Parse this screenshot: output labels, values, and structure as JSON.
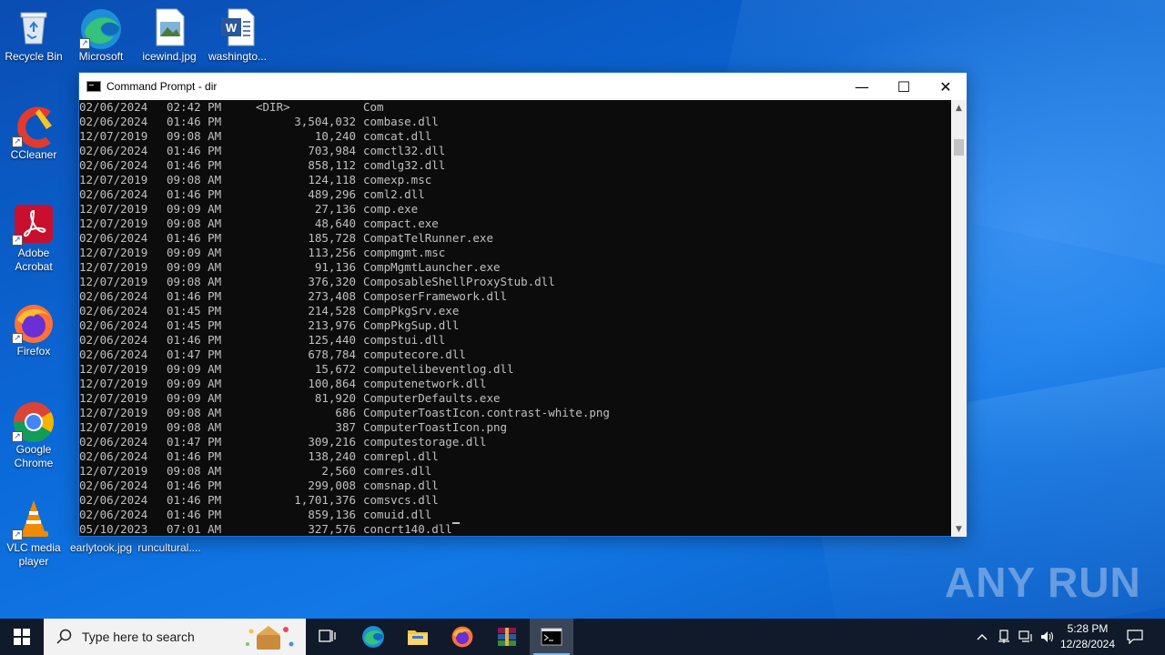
{
  "desktop": {
    "icons": [
      {
        "label": "Recycle Bin"
      },
      {
        "label": "Microsoft Edge"
      },
      {
        "label": "icewind.jpg"
      },
      {
        "label": "washingto..."
      },
      {
        "label": "CCleaner"
      },
      {
        "label": "Adobe Acrobat"
      },
      {
        "label": "Firefox"
      },
      {
        "label": "Google Chrome"
      },
      {
        "label": "VLC media player"
      },
      {
        "label": "earlytook.jpg"
      },
      {
        "label": "runcultural...."
      }
    ],
    "watermark": "ANY RUN"
  },
  "cmd_window": {
    "title": "Command Prompt - dir",
    "minimize": "—",
    "maximize": "☐",
    "close": "✕",
    "lines": [
      {
        "date": "02/06/2024",
        "time": "02:42 PM",
        "size": "<DIR>",
        "name": "Com"
      },
      {
        "date": "02/06/2024",
        "time": "01:46 PM",
        "size": "3,504,032",
        "name": "combase.dll"
      },
      {
        "date": "12/07/2019",
        "time": "09:08 AM",
        "size": "10,240",
        "name": "comcat.dll"
      },
      {
        "date": "02/06/2024",
        "time": "01:46 PM",
        "size": "703,984",
        "name": "comctl32.dll"
      },
      {
        "date": "02/06/2024",
        "time": "01:46 PM",
        "size": "858,112",
        "name": "comdlg32.dll"
      },
      {
        "date": "12/07/2019",
        "time": "09:08 AM",
        "size": "124,118",
        "name": "comexp.msc"
      },
      {
        "date": "02/06/2024",
        "time": "01:46 PM",
        "size": "489,296",
        "name": "coml2.dll"
      },
      {
        "date": "12/07/2019",
        "time": "09:09 AM",
        "size": "27,136",
        "name": "comp.exe"
      },
      {
        "date": "12/07/2019",
        "time": "09:08 AM",
        "size": "48,640",
        "name": "compact.exe"
      },
      {
        "date": "02/06/2024",
        "time": "01:46 PM",
        "size": "185,728",
        "name": "CompatTelRunner.exe"
      },
      {
        "date": "12/07/2019",
        "time": "09:09 AM",
        "size": "113,256",
        "name": "compmgmt.msc"
      },
      {
        "date": "12/07/2019",
        "time": "09:09 AM",
        "size": "91,136",
        "name": "CompMgmtLauncher.exe"
      },
      {
        "date": "12/07/2019",
        "time": "09:08 AM",
        "size": "376,320",
        "name": "ComposableShellProxyStub.dll"
      },
      {
        "date": "02/06/2024",
        "time": "01:46 PM",
        "size": "273,408",
        "name": "ComposerFramework.dll"
      },
      {
        "date": "02/06/2024",
        "time": "01:45 PM",
        "size": "214,528",
        "name": "CompPkgSrv.exe"
      },
      {
        "date": "02/06/2024",
        "time": "01:45 PM",
        "size": "213,976",
        "name": "CompPkgSup.dll"
      },
      {
        "date": "02/06/2024",
        "time": "01:46 PM",
        "size": "125,440",
        "name": "compstui.dll"
      },
      {
        "date": "02/06/2024",
        "time": "01:47 PM",
        "size": "678,784",
        "name": "computecore.dll"
      },
      {
        "date": "12/07/2019",
        "time": "09:09 AM",
        "size": "15,672",
        "name": "computelibeventlog.dll"
      },
      {
        "date": "12/07/2019",
        "time": "09:09 AM",
        "size": "100,864",
        "name": "computenetwork.dll"
      },
      {
        "date": "12/07/2019",
        "time": "09:09 AM",
        "size": "81,920",
        "name": "ComputerDefaults.exe"
      },
      {
        "date": "12/07/2019",
        "time": "09:08 AM",
        "size": "686",
        "name": "ComputerToastIcon.contrast-white.png"
      },
      {
        "date": "12/07/2019",
        "time": "09:08 AM",
        "size": "387",
        "name": "ComputerToastIcon.png"
      },
      {
        "date": "02/06/2024",
        "time": "01:47 PM",
        "size": "309,216",
        "name": "computestorage.dll"
      },
      {
        "date": "02/06/2024",
        "time": "01:46 PM",
        "size": "138,240",
        "name": "comrepl.dll"
      },
      {
        "date": "12/07/2019",
        "time": "09:08 AM",
        "size": "2,560",
        "name": "comres.dll"
      },
      {
        "date": "02/06/2024",
        "time": "01:46 PM",
        "size": "299,008",
        "name": "comsnap.dll"
      },
      {
        "date": "02/06/2024",
        "time": "01:46 PM",
        "size": "1,701,376",
        "name": "comsvcs.dll"
      },
      {
        "date": "02/06/2024",
        "time": "01:46 PM",
        "size": "859,136",
        "name": "comuid.dll"
      },
      {
        "date": "05/10/2023",
        "time": "07:01 AM",
        "size": "327,576",
        "name": "concrt140.dll"
      }
    ]
  },
  "taskbar": {
    "search_placeholder": "Type here to search",
    "clock_time": "5:28 PM",
    "clock_date": "12/28/2024",
    "apps": [
      "Task View",
      "Microsoft Edge",
      "File Explorer",
      "Firefox",
      "WinRAR",
      "Command Prompt"
    ]
  },
  "colors": {
    "console_bg": "#0c0c0c",
    "console_fg": "#c0c0c0",
    "taskbar_bg": "#101a2a",
    "active_indicator": "#76b9ed"
  }
}
